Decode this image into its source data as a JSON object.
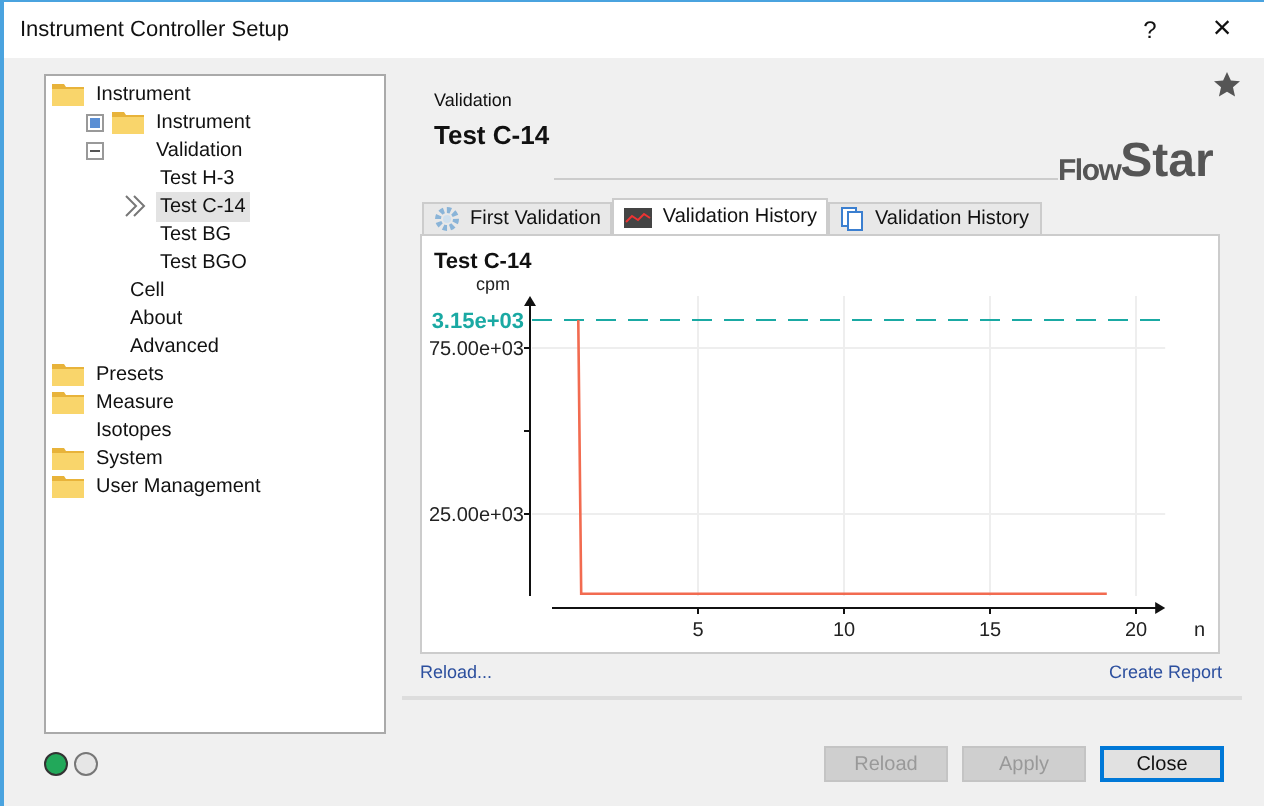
{
  "window": {
    "title": "Instrument Controller Setup",
    "help": "?",
    "close": "×"
  },
  "tree": [
    {
      "label": "Instrument",
      "kind": "folder",
      "selected": false,
      "children": [
        {
          "label": "Instrument",
          "kind": "folder",
          "expanded": false,
          "selected": false
        },
        {
          "label": "Validation",
          "kind": "plain",
          "expanded": true,
          "selected": false,
          "children": [
            {
              "label": "Test H-3",
              "selected": false
            },
            {
              "label": "Test C-14",
              "selected": true
            },
            {
              "label": "Test BG",
              "selected": false
            },
            {
              "label": "Test BGO",
              "selected": false
            }
          ]
        },
        {
          "label": "Cell",
          "kind": "plain",
          "selected": false
        },
        {
          "label": "About",
          "kind": "plain",
          "selected": false
        },
        {
          "label": "Advanced",
          "kind": "plain",
          "selected": false
        }
      ]
    },
    {
      "label": "Presets",
      "kind": "folder",
      "selected": false
    },
    {
      "label": "Measure",
      "kind": "folder",
      "selected": false
    },
    {
      "label": "Isotopes",
      "kind": "plain",
      "selected": false
    },
    {
      "label": "System",
      "kind": "folder",
      "selected": false
    },
    {
      "label": "User Management",
      "kind": "folder",
      "selected": false
    }
  ],
  "header": {
    "section": "Validation",
    "title": "Test C-14",
    "logo_top": "Flow",
    "logo_bottom": "Star"
  },
  "tabs": [
    {
      "label": "First Validation",
      "kind": "gear",
      "selected": false
    },
    {
      "label": "Validation History",
      "kind": "chart",
      "selected": true
    },
    {
      "label": "Validation History",
      "kind": "pages",
      "selected": false
    }
  ],
  "chart_data": {
    "type": "line",
    "title": "Test C-14",
    "ylabel": "cpm",
    "xlabel": "n",
    "x": [
      0.9,
      1,
      19
    ],
    "series": [
      {
        "color": "#f26b50",
        "values": [
          83400,
          1000,
          1000
        ]
      }
    ],
    "xlim": [
      0,
      21
    ],
    "ylim": [
      0,
      85000
    ],
    "xticks": [
      5,
      10,
      15,
      20
    ],
    "grid": true,
    "yticks": [
      {
        "value": 75000,
        "label": "75.00e+03"
      },
      {
        "value": 25000,
        "label": "25.00e+03"
      }
    ],
    "ref_lines": [
      {
        "axis": "y",
        "value": 83400,
        "label": "3.15e+03",
        "color": "#1aa9a3"
      }
    ]
  },
  "links": {
    "reload": "Reload...",
    "report": "Create Report"
  },
  "status_lights": [
    {
      "on": true,
      "color": "#22a85a"
    },
    {
      "on": false,
      "color": "#e6e6e6"
    }
  ],
  "buttons": [
    {
      "label": "Reload",
      "disabled": true
    },
    {
      "label": "Apply",
      "disabled": true
    },
    {
      "label": "Close",
      "disabled": false
    }
  ]
}
